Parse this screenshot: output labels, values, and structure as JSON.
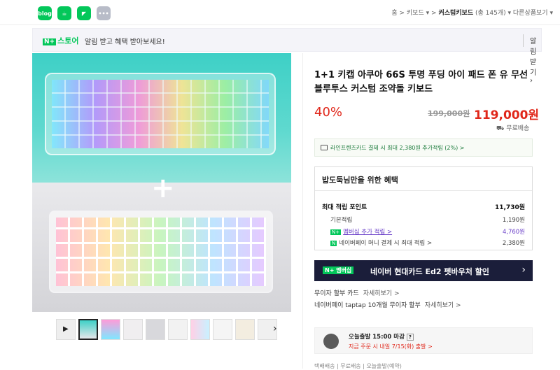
{
  "topbar": {
    "apps": [
      {
        "name": "blog",
        "label": "blog",
        "color": "#03c75a"
      },
      {
        "name": "cafe",
        "label": "☕",
        "color": "#03c75a"
      },
      {
        "name": "bookmark",
        "label": "◤",
        "color": "#03c75a"
      },
      {
        "name": "more",
        "label": "•••",
        "color": "#b8bcc8"
      }
    ],
    "breadcrumb": {
      "home": "홈",
      "sep1": ">",
      "cat1": "키보드",
      "sep2": ">",
      "cat2": "커스텀키보드",
      "count": "(총 145개)",
      "other": "다른상품보기"
    }
  },
  "promo": {
    "store_label": "스토어",
    "n_badge": "N+",
    "message": "알림 받고 혜택 받아보세요!",
    "button": "알림받기"
  },
  "gallery": {
    "plus_sign": "+",
    "next_arrow": "›",
    "thumb_count": 10
  },
  "product": {
    "title": "1+1 키캡 아쿠아 66S 투명 푸딩 아이 패드 폰 유 무선 블루투스 커스텀 조약돌 키보드",
    "discount": "40%",
    "original_price": "199,000원",
    "price": "119,000원",
    "shipping": "무료배송",
    "card_promo": "라인프렌즈카드 결제 시 최대 2,380원 추가적립 (2%) >"
  },
  "benefit": {
    "header": "밥도둑님만을 위한 혜택",
    "rows": [
      {
        "label": "최대 적립 포인트",
        "value": "11,730원"
      },
      {
        "label": "기본적립",
        "value": "1,190원"
      },
      {
        "label": "멤버십 추가 적립 >",
        "value": "4,760원"
      },
      {
        "label": "네이버페이 머니 결제 시 최대 적립 >",
        "value": "2,380원"
      }
    ],
    "n_badge": "N+",
    "pay_badge": "N"
  },
  "banner": {
    "badge": "N+ 멤버십",
    "text": "네이버 현대카드 Ed2 펫바우처 할인",
    "arrow": "›"
  },
  "payment_links": [
    {
      "label": "무이자 할부 카드",
      "action": "자세히보기 >"
    },
    {
      "label": "네이버페이 taptap 10개월 무이자 할부",
      "action": "자세히보기 >"
    }
  ],
  "dispatch": {
    "line1": "오늘출발 15:00 마감",
    "help": "?",
    "line2": "지금 주문 시 내일 7/15(화) 출발 >"
  },
  "cut_text": "택배배송 | 무료배송 | 오늘출발(예약)"
}
